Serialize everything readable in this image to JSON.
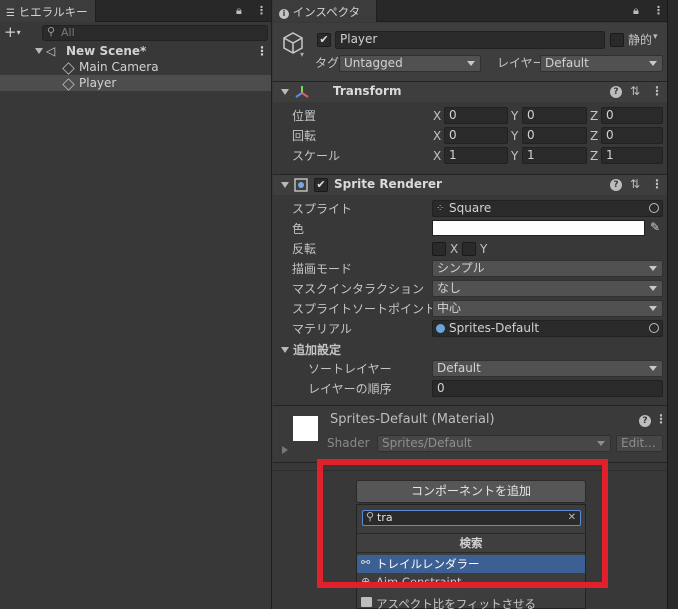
{
  "hierarchy": {
    "tab_label": "ヒエラルキー",
    "search_placeholder": "All",
    "scene_name": "New Scene*",
    "items": [
      "Main Camera",
      "Player"
    ]
  },
  "inspector": {
    "tab_label": "インスペクター",
    "object_name": "Player",
    "static_label": "静的",
    "tag_label": "タグ",
    "tag_value": "Untagged",
    "layer_label": "レイヤー",
    "layer_value": "Default",
    "transform": {
      "title": "Transform",
      "position_label": "位置",
      "rotation_label": "回転",
      "scale_label": "スケール",
      "axis_x": "X",
      "axis_y": "Y",
      "axis_z": "Z",
      "position": [
        "0",
        "0",
        "0"
      ],
      "rotation": [
        "0",
        "0",
        "0"
      ],
      "scale": [
        "1",
        "1",
        "1"
      ]
    },
    "sprite_renderer": {
      "title": "Sprite Renderer",
      "sprite_label": "スプライト",
      "sprite_value": "Square",
      "color_label": "色",
      "color_value": "#ffffff",
      "flip_label": "反転",
      "flip_x": "X",
      "flip_y": "Y",
      "draw_mode_label": "描画モード",
      "draw_mode_value": "シンプル",
      "mask_label": "マスクインタラクション",
      "mask_value": "なし",
      "sort_point_label": "スプライトソートポイント",
      "sort_point_value": "中心",
      "material_label": "マテリアル",
      "material_value": "Sprites-Default",
      "additional_label": "追加設定",
      "sorting_layer_label": "ソートレイヤー",
      "sorting_layer_value": "Default",
      "order_label": "レイヤーの順序",
      "order_value": "0"
    },
    "material": {
      "title": "Sprites-Default (Material)",
      "shader_label": "Shader",
      "shader_value": "Sprites/Default",
      "edit_label": "Edit..."
    }
  },
  "popup": {
    "add_component_label": "コンポーネントを追加",
    "search_value": "tra",
    "section_title": "検索",
    "results": [
      "トレイルレンダラー",
      "Aim Constraint",
      "アスペクト比をフィットさせる"
    ]
  }
}
